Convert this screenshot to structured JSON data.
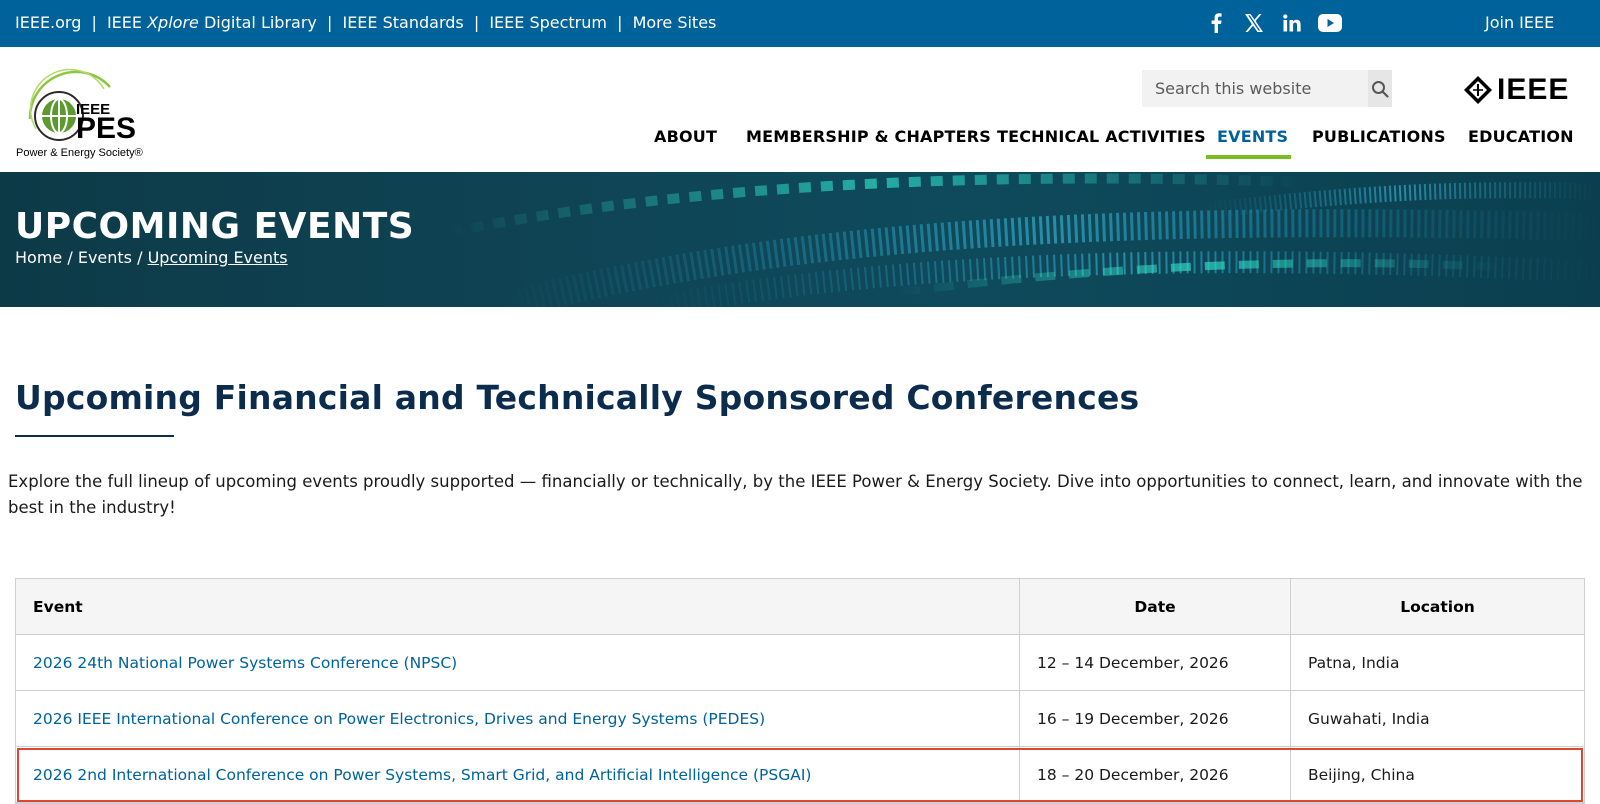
{
  "topbar": {
    "links": [
      "IEEE.org",
      "IEEE",
      "Xplore",
      "Digital Library",
      "IEEE Standards",
      "IEEE Spectrum",
      "More Sites"
    ],
    "join": "Join IEEE",
    "social_icons": [
      "facebook-icon",
      "x-icon",
      "linkedin-icon",
      "youtube-icon"
    ]
  },
  "header": {
    "logo": {
      "top_text": "IEEE",
      "main_text": "PES",
      "tagline": "Power & Energy Society®"
    },
    "search": {
      "placeholder": "Search this website"
    },
    "ieee_logo": "IEEE",
    "nav": [
      "ABOUT",
      "MEMBERSHIP & CHAPTERS",
      "TECHNICAL ACTIVITIES",
      "EVENTS",
      "PUBLICATIONS",
      "EDUCATION"
    ],
    "active_nav": "EVENTS"
  },
  "hero": {
    "title": "UPCOMING EVENTS",
    "breadcrumb": [
      "Home",
      "Events",
      "Upcoming Events"
    ]
  },
  "main": {
    "heading": "Upcoming Financial and Technically Sponsored Conferences",
    "intro": "Explore the full lineup of upcoming events proudly supported — financially or technically, by the IEEE Power & Energy Society. Dive into opportunities to connect, learn, and innovate with the best in the industry!",
    "table": {
      "headers": [
        "Event",
        "Date",
        "Location"
      ],
      "rows": [
        {
          "event": "2026 24th National Power Systems Conference (NPSC)",
          "date": "12 – 14 December, 2026",
          "location": "Patna, India"
        },
        {
          "event": "2026 IEEE International Conference on Power Electronics, Drives and Energy Systems (PEDES)",
          "date": "16 – 19 December, 2026",
          "location": "Guwahati, India"
        },
        {
          "event": "2026 2nd International Conference on Power Systems, Smart Grid, and Artificial Intelligence (PSGAI)",
          "date": "18 – 20 December, 2026",
          "location": "Beijing, China"
        }
      ]
    }
  },
  "colors": {
    "brand_blue": "#00629b",
    "nav_green": "#78be20",
    "heading_navy": "#0b2c4d",
    "highlight_red": "#e0452f"
  }
}
